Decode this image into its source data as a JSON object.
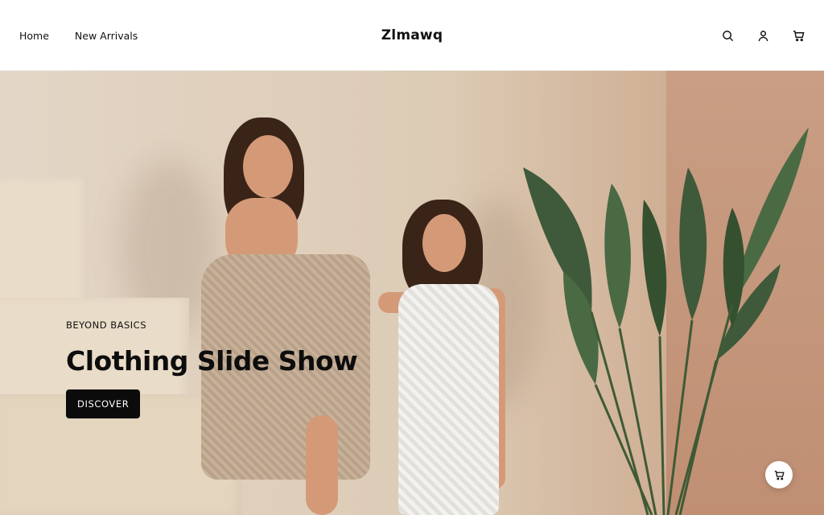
{
  "header": {
    "nav": [
      {
        "label": "Home"
      },
      {
        "label": "New Arrivals"
      }
    ],
    "logo": "Zlmawq",
    "icons": [
      "search-icon",
      "user-icon",
      "cart-icon"
    ]
  },
  "hero": {
    "eyebrow": "BEYOND BASICS",
    "title": "Clothing Slide Show",
    "cta_label": "DISCOVER"
  },
  "floating": {
    "icon": "cart-icon"
  },
  "colors": {
    "accent": "#0b0b0b",
    "background": "#ffffff"
  }
}
